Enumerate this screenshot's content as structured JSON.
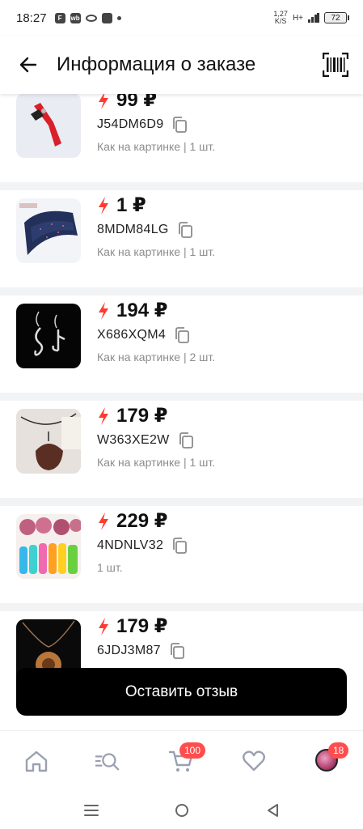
{
  "status_bar": {
    "time": "18:27",
    "icons": [
      "f-icon",
      "wb-icon",
      "ring-icon",
      "chart-icon",
      "dot-icon"
    ],
    "net_speed_value": "1,27",
    "net_speed_unit": "K/S",
    "network_type": "H+",
    "battery_level": "72"
  },
  "header": {
    "title": "Информация о заказе",
    "back_icon": "arrow-left-icon",
    "action_icon": "barcode-icon"
  },
  "items": [
    {
      "price": "99 ₽",
      "code": "J54DM6D9",
      "meta": "Как на картинке | 1 шт.",
      "thumb": "corkscrew"
    },
    {
      "price": "1 ₽",
      "code": "8MDM84LG",
      "meta": "Как на картинке | 1 шт.",
      "thumb": "tie"
    },
    {
      "price": "194 ₽",
      "code": "X686XQM4",
      "meta": "Как на картинке | 2 шт.",
      "thumb": "earrings"
    },
    {
      "price": "179 ₽",
      "code": "W363XE2W",
      "meta": "Как на картинке | 1 шт.",
      "thumb": "pendant"
    },
    {
      "price": "229 ₽",
      "code": "4NDNLV32",
      "meta": "1 шт.",
      "thumb": "silicone-molds"
    },
    {
      "price": "179 ₽",
      "code": "6JDJ3M87",
      "meta": "",
      "thumb": "necklace"
    }
  ],
  "cta": {
    "label": "Оставить отзыв"
  },
  "tabbar": {
    "tabs": [
      "home-icon",
      "catalog-search-icon",
      "cart-icon",
      "favorites-icon",
      "profile-avatar"
    ],
    "cart_badge": "100",
    "profile_badge": "18"
  },
  "colors": {
    "accent": "#ff3b30",
    "badge": "#ff4d4d",
    "cta_bg": "#000000",
    "separator": "#f2f3f5"
  }
}
